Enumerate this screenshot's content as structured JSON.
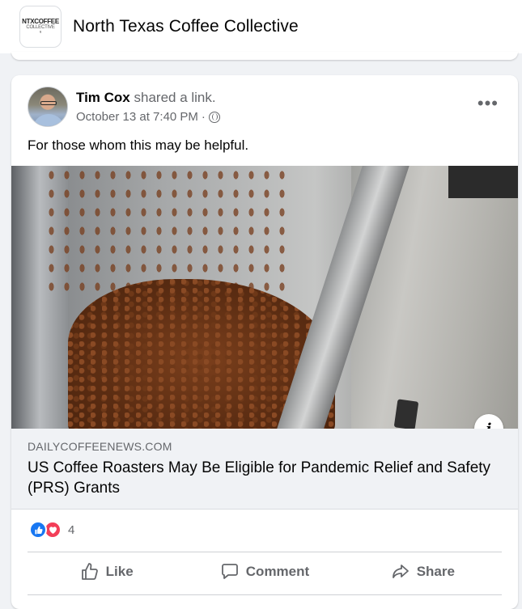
{
  "group": {
    "name": "North Texas Coffee Collective",
    "logo_line1": "NTXCOFFEE",
    "logo_line2": "COLLECTIVE"
  },
  "post": {
    "author": "Tim Cox",
    "action": "shared a link.",
    "timestamp": "October 13 at 7:40 PM",
    "privacy_separator": "·",
    "privacy_icon": "globe-icon",
    "text": "For those whom this may be helpful.",
    "more_label": "•••"
  },
  "link": {
    "domain": "DAILYCOFFEENEWS.COM",
    "title": "US Coffee Roasters May Be Eligible for Pandemic Relief and Safety (PRS) Grants",
    "info_label": "i"
  },
  "reactions": {
    "types": [
      "like",
      "love"
    ],
    "count": "4",
    "like_color": "#1877f2",
    "love_color": "#f33e58"
  },
  "actions": {
    "like_label": "Like",
    "comment_label": "Comment",
    "share_label": "Share"
  }
}
